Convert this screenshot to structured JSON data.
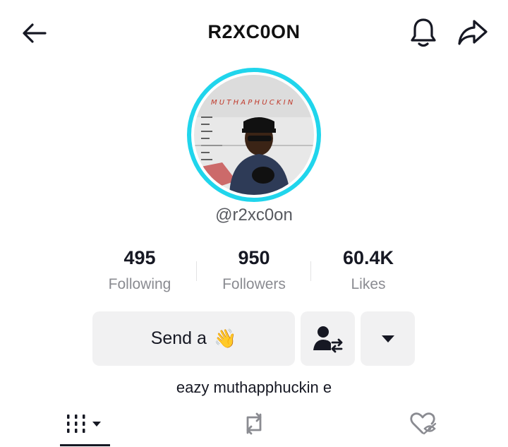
{
  "header": {
    "title": "R2XC0ON",
    "back_icon": "arrow-left-icon",
    "bell_icon": "bell-icon",
    "share_icon": "share-arrow-icon"
  },
  "profile": {
    "handle": "@r2xc0on",
    "avatar_ring_color": "#20d5ec",
    "bio": "eazy muthapphuckin e"
  },
  "stats": [
    {
      "value": "495",
      "label": "Following"
    },
    {
      "value": "950",
      "label": "Followers"
    },
    {
      "value": "60.4K",
      "label": "Likes"
    }
  ],
  "actions": {
    "send_label": "Send a",
    "send_emoji": "👋",
    "friend_icon": "user-swap-icon",
    "more_icon": "caret-down-icon"
  },
  "tabs": [
    {
      "name": "videos",
      "icon": "grid-bars-icon",
      "selected": true
    },
    {
      "name": "reposts",
      "icon": "repost-icon",
      "selected": false
    },
    {
      "name": "liked",
      "icon": "hidden-heart-icon",
      "selected": false
    }
  ]
}
